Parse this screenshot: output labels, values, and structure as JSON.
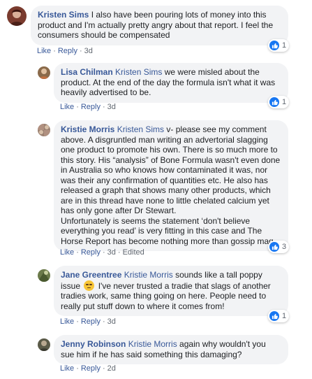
{
  "comments": [
    {
      "author": "Kristen Sims",
      "mention": "",
      "text": "I also have been pouring lots of money into this product and I'm actually pretty angry about that report. I feel the consumers should be compensated",
      "like_label": "Like",
      "reply_label": "Reply",
      "time": "3d",
      "edited": "",
      "reactions": "1",
      "avatar_color": "#7a3b2e"
    },
    {
      "author": "Lisa Chilman",
      "mention": "Kristen Sims",
      "text": "we were misled about the product. At the end of the day the formula isn't what it was heavily advertised to be.",
      "like_label": "Like",
      "reply_label": "Reply",
      "time": "3d",
      "edited": "",
      "reactions": "1",
      "avatar_color": "#8a6a4a"
    },
    {
      "author": "Kristie Morris",
      "mention": "Kristen Sims",
      "text": "v- please see my comment above. A disgruntled man writing an advertorial slagging one product to promote his own. There is so much more to this story. His “analysis” of Bone Formula wasn't even done in Australia so who knows how contaminated it was, nor was their any confirmation of quantities etc. He also has released a graph that shows many other products, which are in this thread have none to little chelated calcium yet has only gone after Dr Stewart.",
      "text2": "Unfortunately is seems the statement ‘don't believe everything you read’ is very fitting in this case and The Horse Report has become nothing more than gossip mag.",
      "like_label": "Like",
      "reply_label": "Reply",
      "time": "3d",
      "edited": "Edited",
      "reactions": "3",
      "avatar_color": "#9a8070"
    },
    {
      "author": "Jane Greentree",
      "mention": "Kristie Morris",
      "text": "sounds like a tall poppy issue",
      "text2": "I've never trusted a tradie that slags of another tradies work, same thing going on here. People need to really put stuff down to where it comes from!",
      "like_label": "Like",
      "reply_label": "Reply",
      "time": "3d",
      "edited": "",
      "reactions": "1",
      "avatar_color": "#6b7a4a"
    },
    {
      "author": "Jenny Robinson",
      "mention": "Kristie Morris",
      "text": "again why wouldn't you sue him if he has said something this damaging?",
      "like_label": "Like",
      "reply_label": "Reply",
      "time": "2d",
      "edited": "",
      "reactions": "",
      "avatar_color": "#5a5a48"
    }
  ],
  "icons": {
    "like": "thumbs-up-icon",
    "sad": "sad-face-emoji-icon"
  }
}
